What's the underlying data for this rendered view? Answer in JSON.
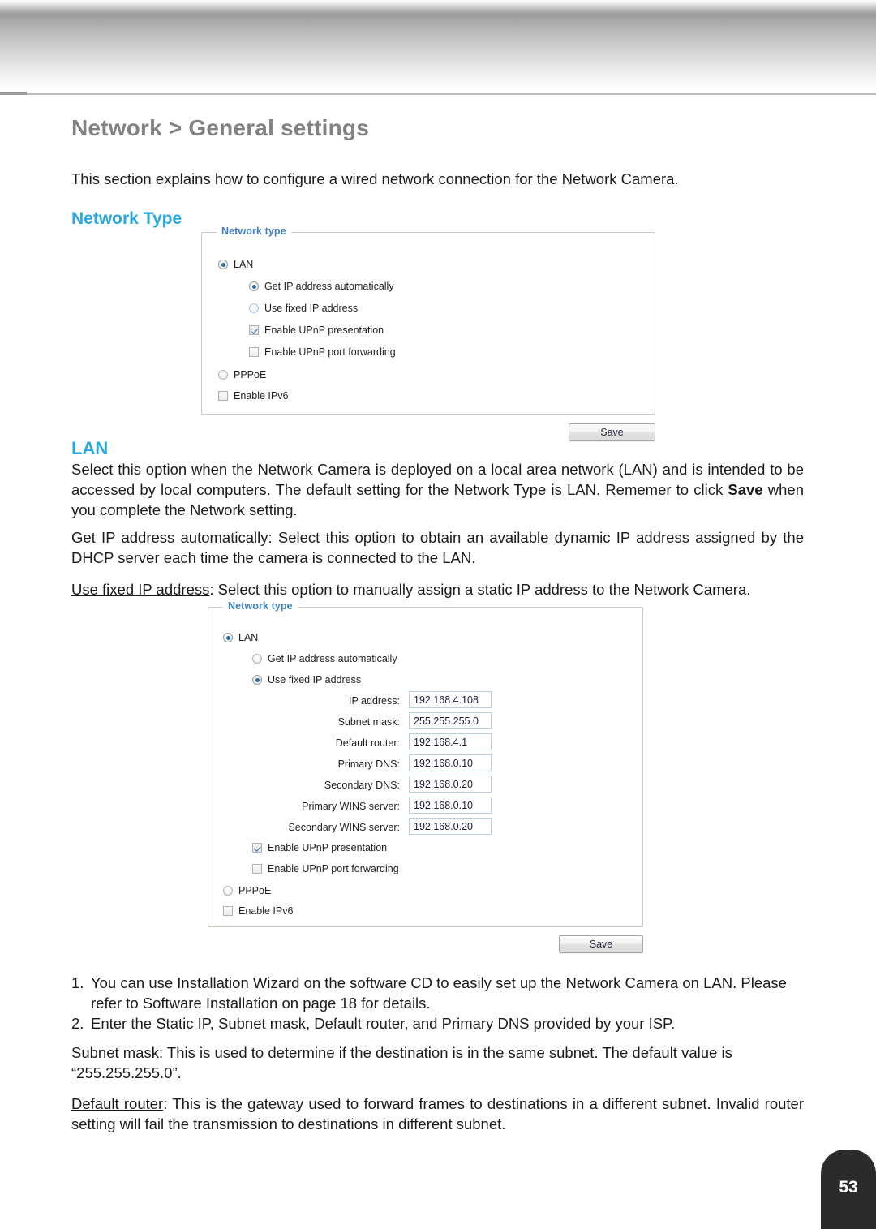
{
  "document": {
    "page_number": "53",
    "title": "Network > General settings",
    "intro": "This section explains how to configure a wired network connection for the Network Camera.",
    "headings": {
      "network_type": "Network Type",
      "lan": "LAN"
    },
    "paragraphs": {
      "lan_desc_a": "Select this option when the Network Camera is deployed on a local area network (LAN) and is intended to be accessed by local computers. The default setting for the Network Type is LAN. Rememer to click ",
      "lan_desc_bold": "Save",
      "lan_desc_b": " when you complete the Network setting.",
      "get_ip_term": "Get IP address automatically",
      "get_ip_desc": ": Select this option to obtain an available dynamic IP address assigned by the DHCP server each time the camera is connected to the LAN.",
      "fixed_ip_term": "Use fixed IP address",
      "fixed_ip_desc": ": Select this option to manually assign a static IP address to the Network Camera.",
      "subnet_term": "Subnet mask",
      "subnet_desc": ": This is used to determine if the destination is in the same subnet. The default value is “255.255.255.0”.",
      "router_term": "Default router",
      "router_desc": ": This is the gateway used to forward frames to destinations in a different subnet. Invalid router setting will fail the transmission to destinations in different subnet."
    },
    "numbered_notes": [
      {
        "marker": "1.",
        "text": "You can use Installation Wizard on the software CD to easily set up the Network Camera on LAN. Please refer to Software Installation on page 18 for details."
      },
      {
        "marker": "2.",
        "text": "Enter the Static IP, Subnet mask, Default router, and Primary DNS provided by your ISP."
      }
    ]
  },
  "panel_one": {
    "legend": "Network type",
    "options": {
      "lan": "LAN",
      "get_ip": "Get IP address automatically",
      "fixed_ip": "Use fixed IP address",
      "upnp_presentation": "Enable UPnP presentation",
      "upnp_forwarding": "Enable UPnP port forwarding",
      "pppoe": "PPPoE",
      "ipv6": "Enable IPv6"
    },
    "save_label": "Save"
  },
  "panel_two": {
    "legend": "Network type",
    "options": {
      "lan": "LAN",
      "get_ip": "Get IP address automatically",
      "fixed_ip": "Use fixed IP address",
      "upnp_presentation": "Enable UPnP presentation",
      "upnp_forwarding": "Enable UPnP port forwarding",
      "pppoe": "PPPoE",
      "ipv6": "Enable IPv6"
    },
    "fields": [
      {
        "label": "IP address:",
        "value": "192.168.4.108"
      },
      {
        "label": "Subnet mask:",
        "value": "255.255.255.0"
      },
      {
        "label": "Default router:",
        "value": "192.168.4.1"
      },
      {
        "label": "Primary DNS:",
        "value": "192.168.0.10"
      },
      {
        "label": "Secondary DNS:",
        "value": "192.168.0.20"
      },
      {
        "label": "Primary WINS server:",
        "value": "192.168.0.10"
      },
      {
        "label": "Secondary WINS server:",
        "value": "192.168.0.20"
      }
    ],
    "save_label": "Save"
  },
  "colors": {
    "accent_blue": "#2aa9e0",
    "legend_blue": "#3d7fc1",
    "title_gray": "#828282",
    "badge_dark": "#2b2b2b"
  }
}
